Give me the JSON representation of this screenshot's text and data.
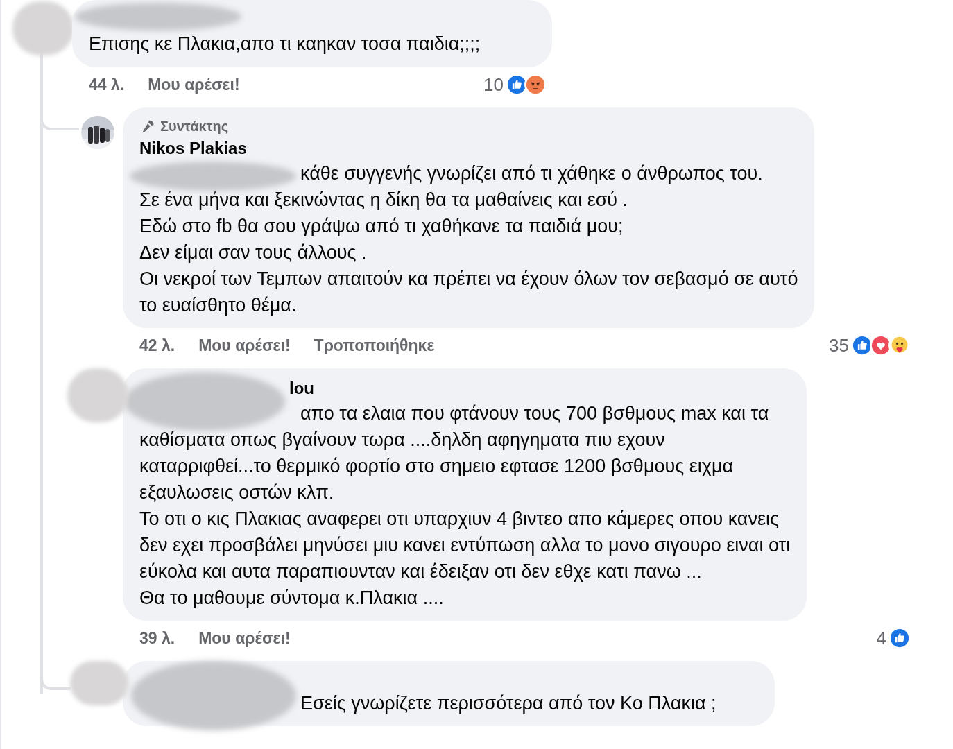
{
  "comment": {
    "avatar": {
      "kind": "blurred"
    },
    "obscured": true,
    "lines": [
      "Επισης κε Πλακια,απο τι καηκαν τοσα παιδια;;;;"
    ],
    "time": "44 λ.",
    "like": "Μου αρέσει!",
    "reaction_count": "10",
    "reactions": [
      {
        "kind": "like"
      },
      {
        "kind": "angry"
      }
    ]
  },
  "replies": [
    {
      "obscured": true,
      "badge": "Συντάκτης",
      "name": "Nikos Plakias",
      "lines": [
        "κάθε συγγενής γνωρίζει από τι χάθηκε ο άνθρωπος του.",
        "Σε ένα μήνα και ξεκινώντας η δίκη θα τα μαθαίνεις και εσύ .",
        "Εδώ στο fb θα σου γράψω από τι χαθήκανε τα παιδιά μου;",
        "Δεν είμαι σαν τους άλλους .",
        "Οι νεκροί των Τεμπων απαιτούν κα πρέπει να έχουν όλων τον σεβασμό σε αυτό",
        "το ευαίσθητο θέμα."
      ],
      "time": "42 λ.",
      "like": "Μου αρέσει!",
      "edited": "Τροποποιήθηκε",
      "reaction_count": "35",
      "reactions": [
        {
          "kind": "like"
        },
        {
          "kind": "love"
        },
        {
          "kind": "care"
        }
      ]
    },
    {
      "avatar": {
        "kind": "blurred"
      },
      "obscured": true,
      "name": "lou",
      "lines": [
        "απο τα ελαια που φτάνουν τους 700 βσθμους max και τα",
        "καθίσματα οπως βγαίνουν τωρα ....δηλδη αφηγηματα πιυ εχουν",
        "καταρριφθεί...το θερμικό φορτίο στο σημειο εφτασε 1200 βσθμους ειχμα",
        "εξαυλωσεις οστών κλπ.",
        "Το οτι ο κις Πλακιας αναφερει οτι υπαρχιυν 4 βιντεο απο κάμερες οπου κανεις",
        "δεν εχει προσβάλει μηνύσει μιυ κανει εντύπωση αλλα το μονο σιγουρο ειναι οτι",
        "εύκολα και αυτα παραπιουνταν και έδειξαν οτι δεν εθχε κατι πανω ...",
        "Θα το μαθουμε σύντομα κ.Πλακια ...."
      ],
      "time": "39 λ.",
      "like": "Μου αρέσει!",
      "reaction_count": "4",
      "reactions": [
        {
          "kind": "like"
        }
      ]
    },
    {
      "avatar": {
        "kind": "blurred"
      },
      "obscured": true,
      "lines": [
        "Εσείς γνωρίζετε περισσότερα από τον Κο Πλακια ;"
      ]
    }
  ]
}
